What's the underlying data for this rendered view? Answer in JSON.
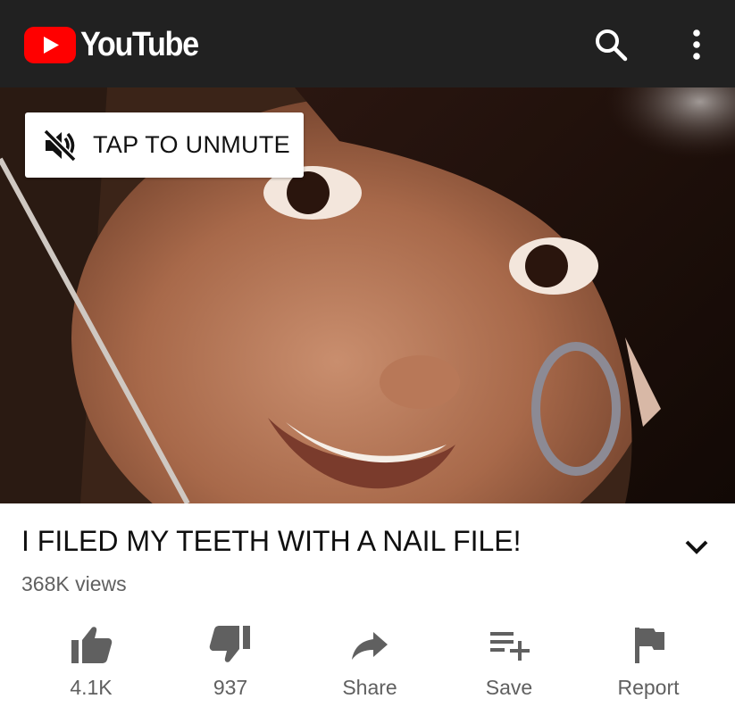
{
  "header": {
    "brand": "YouTube",
    "icons": [
      "search-icon",
      "more-vert-icon"
    ],
    "colors": {
      "bar": "#212121",
      "brand_red": "#ff0000"
    }
  },
  "player": {
    "unmute_label": "TAP TO UNMUTE",
    "unmute_icon": "volume-off-icon"
  },
  "video": {
    "title": "I FILED MY TEETH WITH A NAIL FILE!",
    "views": "368K views"
  },
  "actions": [
    {
      "icon": "thumb-up-icon",
      "label": "4.1K"
    },
    {
      "icon": "thumb-down-icon",
      "label": "937"
    },
    {
      "icon": "share-icon",
      "label": "Share"
    },
    {
      "icon": "playlist-add-icon",
      "label": "Save"
    },
    {
      "icon": "flag-icon",
      "label": "Report"
    }
  ]
}
